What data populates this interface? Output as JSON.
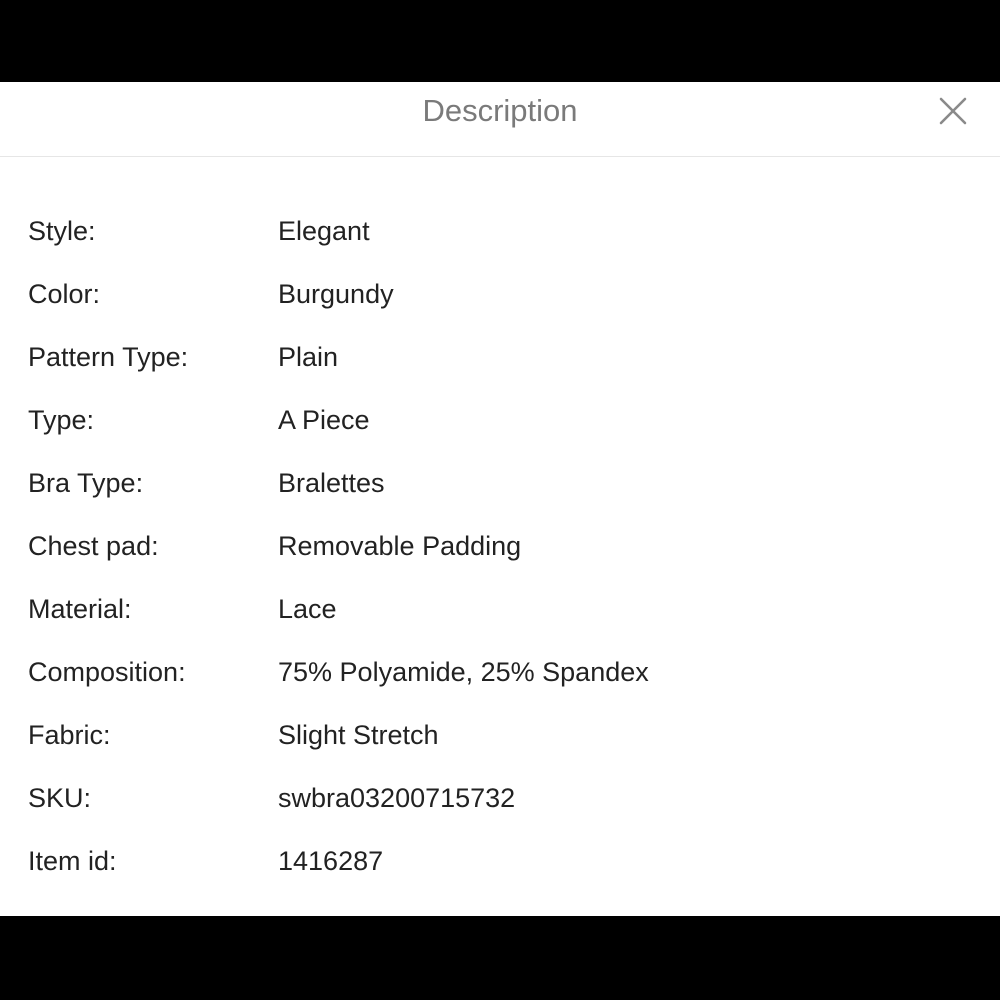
{
  "header": {
    "title": "Description",
    "close_icon": "close-icon"
  },
  "details": [
    {
      "label": "Style:",
      "value": "Elegant"
    },
    {
      "label": "Color:",
      "value": "Burgundy"
    },
    {
      "label": "Pattern Type:",
      "value": "Plain"
    },
    {
      "label": "Type:",
      "value": "A Piece"
    },
    {
      "label": "Bra Type:",
      "value": "Bralettes"
    },
    {
      "label": "Chest pad:",
      "value": "Removable Padding"
    },
    {
      "label": "Material:",
      "value": "Lace"
    },
    {
      "label": "Composition:",
      "value": "75% Polyamide, 25% Spandex"
    },
    {
      "label": "Fabric:",
      "value": "Slight Stretch"
    },
    {
      "label": "SKU:",
      "value": "swbra03200715732"
    },
    {
      "label": "Item id:",
      "value": "1416287"
    }
  ],
  "colors": {
    "title": "#7a7a7a",
    "text": "#222222",
    "close_icon": "#8a8a8a",
    "background": "#ffffff",
    "letterbox": "#000000"
  }
}
